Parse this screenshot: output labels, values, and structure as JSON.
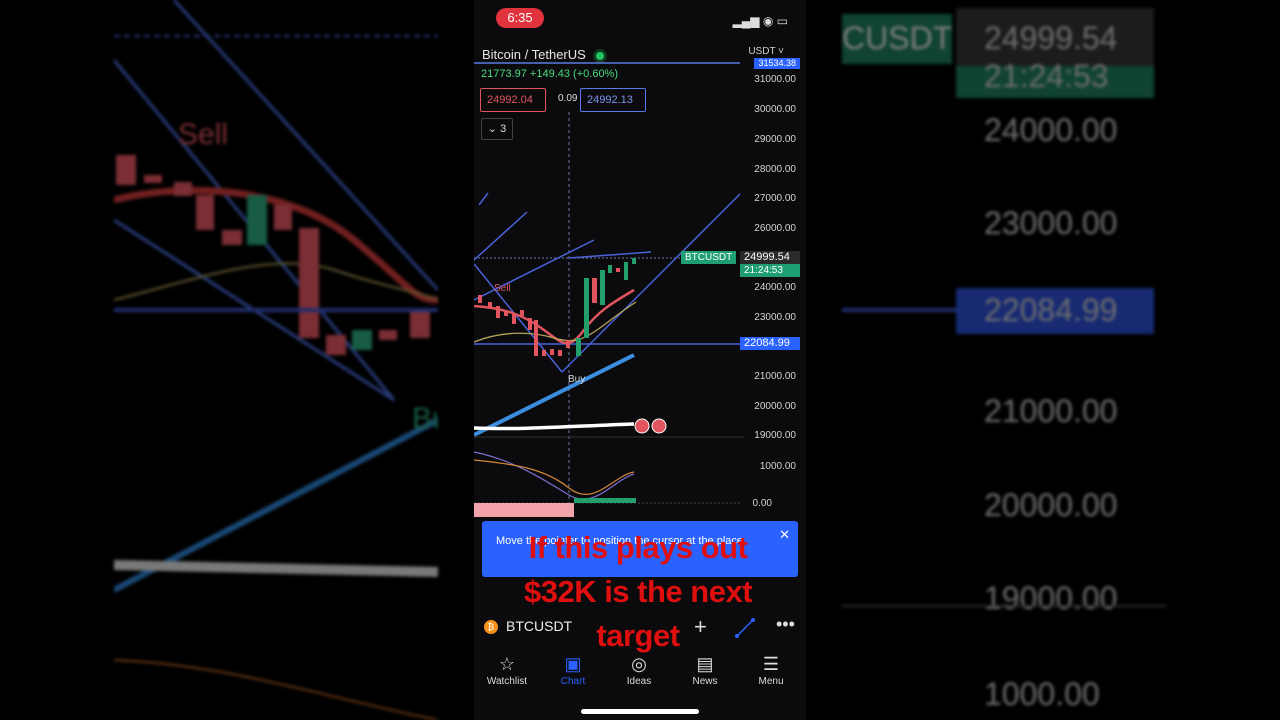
{
  "status_bar": {
    "time": "6:35",
    "icons": "▂▄▆ ◉ ▭"
  },
  "header": {
    "symbol_title": "Bitcoin / TetherUS",
    "currency": "USDT",
    "price_change": "21773.97 +149.43 (+0.60%)",
    "bid": "24992.04",
    "spread": "0.09",
    "ask": "24992.13",
    "intervals_count": "3"
  },
  "y_axis": [
    "31000.00",
    "30000.00",
    "29000.00",
    "28000.00",
    "27000.00",
    "26000.00",
    "24000.00",
    "23000.00",
    "21000.00",
    "20000.00",
    "19000.00"
  ],
  "tags": {
    "top_price": "31534.38",
    "symbol_tag": "BTCUSDT",
    "current_price": "24999.54",
    "countdown": "21:24:53",
    "support_price": "22084.99"
  },
  "indicator_axis": [
    "1000.00",
    "0.00"
  ],
  "chart_labels": {
    "sell": "Sell",
    "buy": "Buy"
  },
  "banner": {
    "text": "Move the pointer to position the cursor at the place",
    "close": "✕"
  },
  "overlay": {
    "line1": "If this plays out",
    "line2": "$32K is the next",
    "line3": "target"
  },
  "symbol_bar": {
    "coin": "₿",
    "symbol": "BTCUSDT",
    "plus": "+",
    "more": "•••"
  },
  "tabs": [
    {
      "label": "Watchlist",
      "icon": "☆"
    },
    {
      "label": "Chart",
      "icon": "▣"
    },
    {
      "label": "Ideas",
      "icon": "◎"
    },
    {
      "label": "News",
      "icon": "▤"
    },
    {
      "label": "Menu",
      "icon": "☰"
    }
  ],
  "background_right": {
    "symbol_tag": "CUSDT",
    "prices": [
      "24999.54",
      "21:24:53",
      "24000.00",
      "23000.00",
      "22084.99",
      "21000.00",
      "20000.00",
      "19000.00",
      "1000.00"
    ]
  },
  "background_left": {
    "sell": "Sell",
    "buy": "Bu"
  },
  "colors": {
    "accent": "#2962ff",
    "up": "#22a06b",
    "down": "#e0555e",
    "overlay": "#e00f0f"
  }
}
